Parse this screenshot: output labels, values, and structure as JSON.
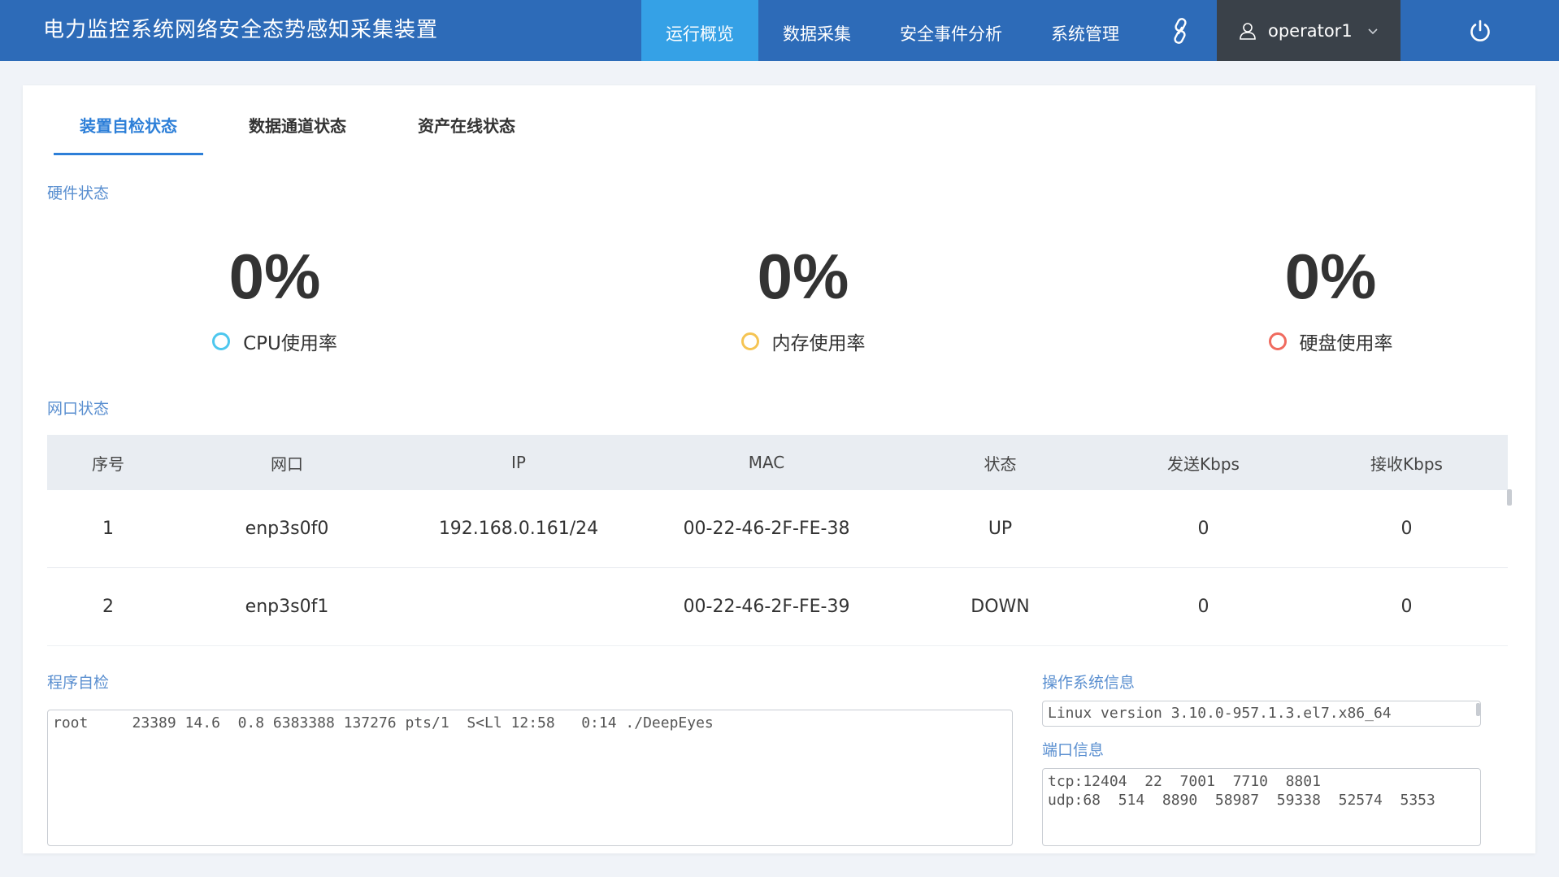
{
  "header": {
    "app_title": "电力监控系统网络安全态势感知采集装置",
    "nav": [
      "运行概览",
      "数据采集",
      "安全事件分析",
      "系统管理"
    ],
    "username": "operator1",
    "accent": "#35a1e6",
    "brand": "#2d6bb8"
  },
  "tabs": [
    "装置自检状态",
    "数据通道状态",
    "资产在线状态"
  ],
  "hardware": {
    "section_label": "硬件状态",
    "metrics": [
      {
        "value": "0%",
        "label": "CPU使用率",
        "color": "#4dc7ee"
      },
      {
        "value": "0%",
        "label": "内存使用率",
        "color": "#f5c453"
      },
      {
        "value": "0%",
        "label": "硬盘使用率",
        "color": "#f06b5f"
      }
    ]
  },
  "network": {
    "section_label": "网口状态",
    "columns": [
      "序号",
      "网口",
      "IP",
      "MAC",
      "状态",
      "发送Kbps",
      "接收Kbps"
    ],
    "rows": [
      [
        "1",
        "enp3s0f0",
        "192.168.0.161/24",
        "00-22-46-2F-FE-38",
        "UP",
        "0",
        "0"
      ],
      [
        "2",
        "enp3s0f1",
        "",
        "00-22-46-2F-FE-39",
        "DOWN",
        "0",
        "0"
      ]
    ]
  },
  "program_check": {
    "section_label": "程序自检",
    "text": "root     23389 14.6  0.8 6383388 137276 pts/1  S<Ll 12:58   0:14 ./DeepEyes"
  },
  "os_info": {
    "section_label": "操作系统信息",
    "text": "Linux version 3.10.0-957.1.3.el7.x86_64"
  },
  "port_info": {
    "section_label": "端口信息",
    "text": "tcp:12404  22  7001  7710  8801\nudp:68  514  8890  58987  59338  52574  5353"
  }
}
